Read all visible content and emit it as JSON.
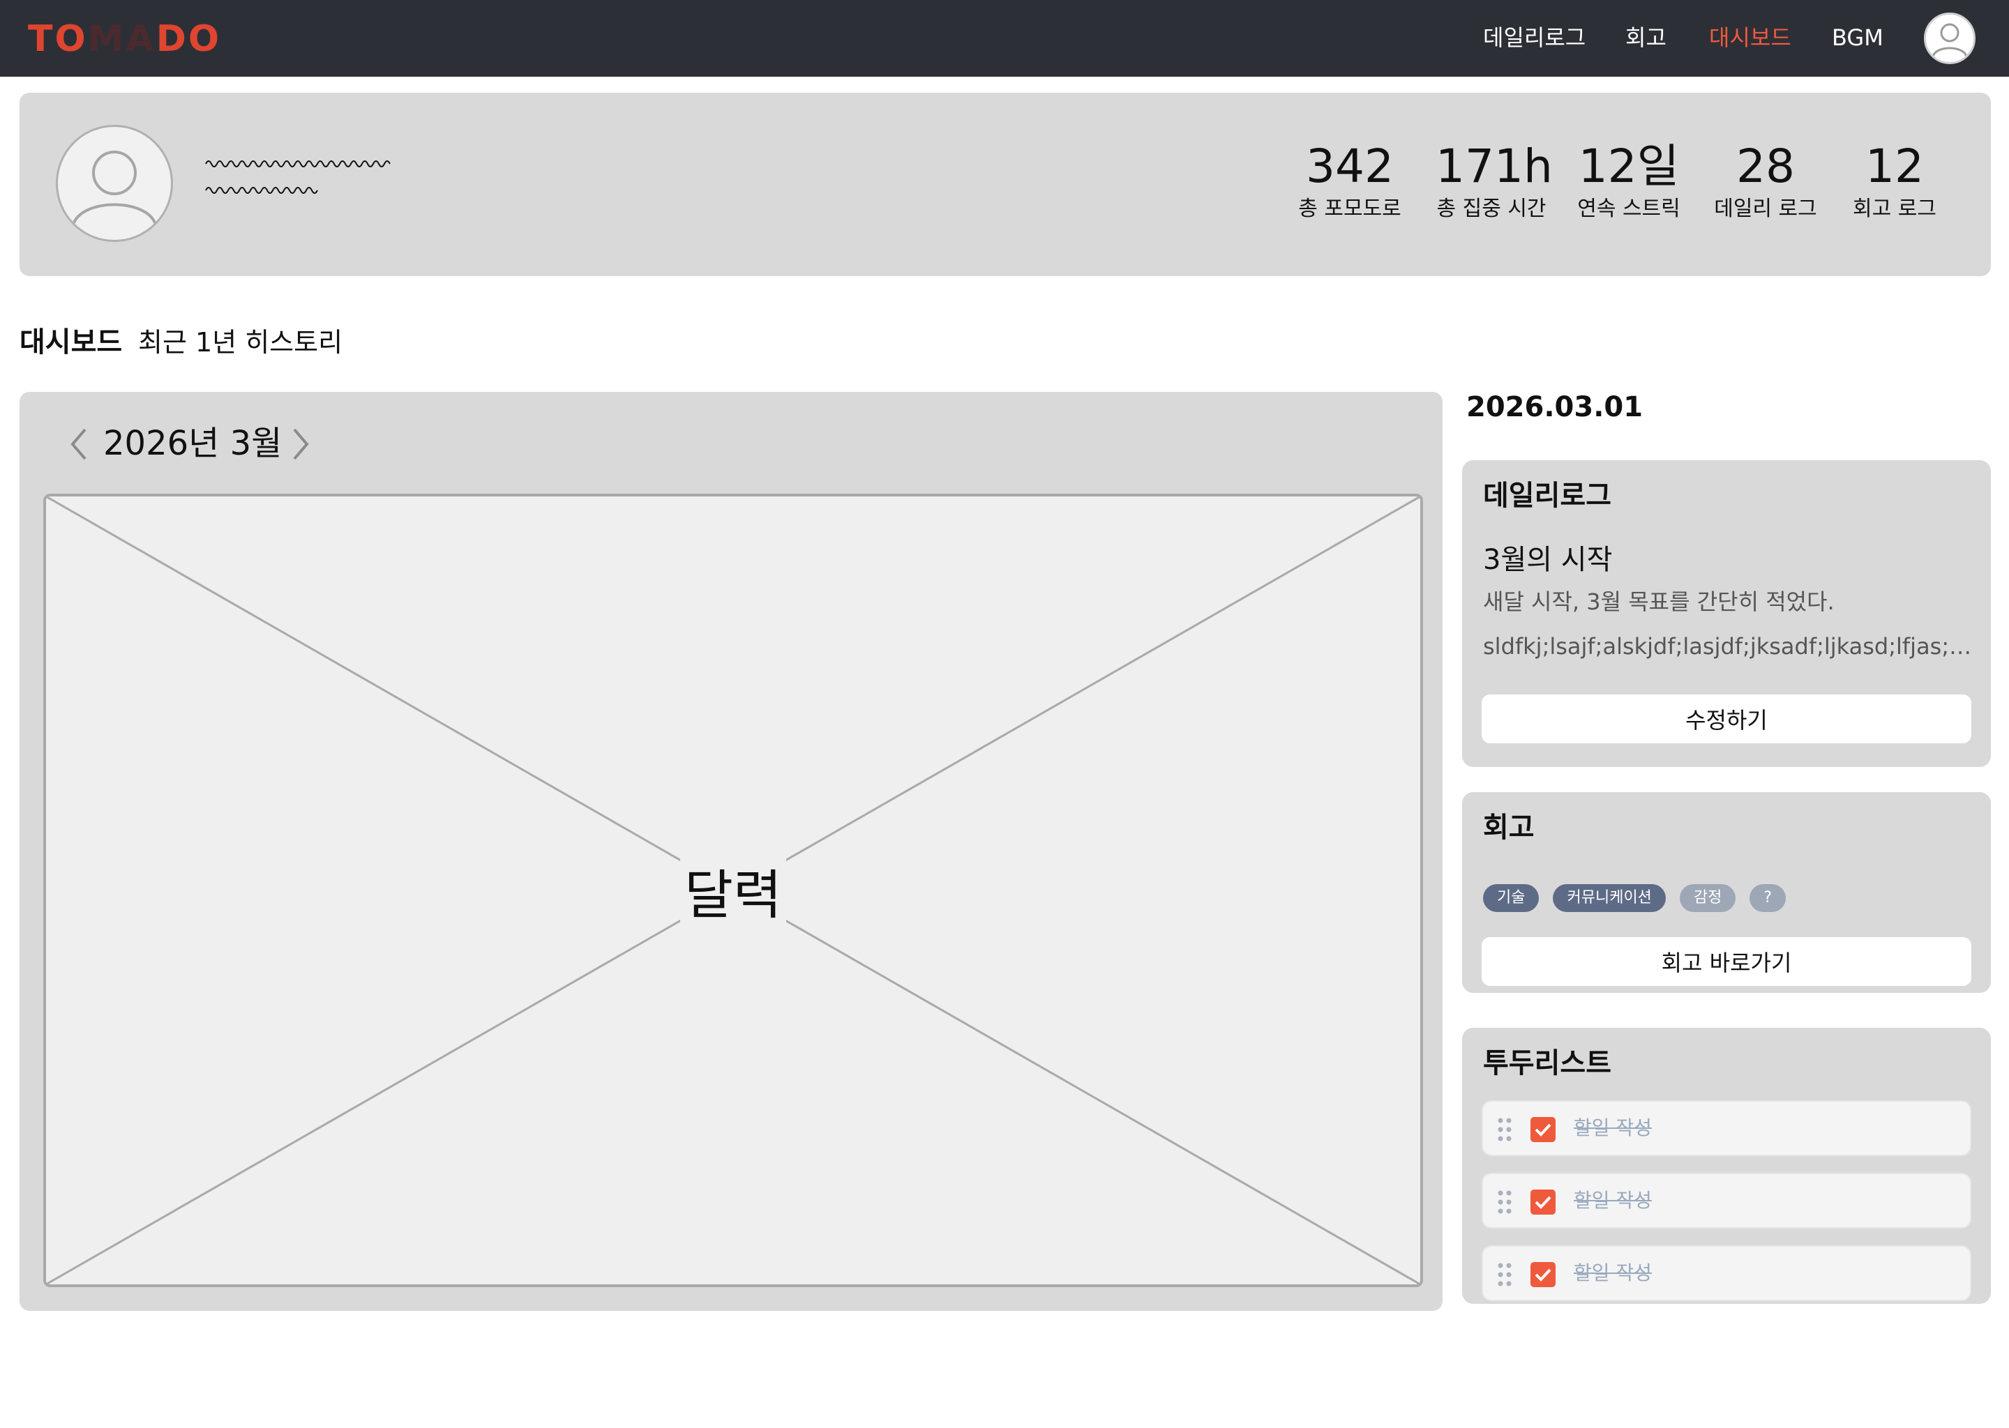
{
  "app": {
    "logo": "TOMADO",
    "logo_color": "#e0452f"
  },
  "nav": {
    "items": [
      {
        "label": "데일리로그",
        "active": false
      },
      {
        "label": "회고",
        "active": false
      },
      {
        "label": "대시보드",
        "active": true
      },
      {
        "label": "BGM",
        "active": false
      }
    ],
    "active_color": "#ef5a3c",
    "avatar_icon": "user-avatar-icon"
  },
  "profile": {
    "avatar_icon": "user-avatar-icon",
    "stats": [
      {
        "value": "342",
        "label": "총 포모도로"
      },
      {
        "value": "171h",
        "label": "총 집중 시간"
      },
      {
        "value": "12일",
        "label": "연속 스트릭"
      },
      {
        "value": "28",
        "label": "데일리 로그"
      },
      {
        "value": "12",
        "label": "회고 로그"
      }
    ]
  },
  "dashboard": {
    "title": "대시보드",
    "subtitle": "최근 1년 히스토리"
  },
  "calendar": {
    "month_label": "2026년 3월",
    "placeholder_label": "달력",
    "prev_icon": "chevron-left-icon",
    "next_icon": "chevron-right-icon"
  },
  "selected_date": "2026.03.01",
  "daily_log": {
    "title": "데일리로그",
    "entry_title": "3월의 시작",
    "entry_summary": "새달 시작, 3월 목표를 간단히 적었다.",
    "entry_body": "sldfkj;lsajf;alskjdf;lasjdf;jksadf;ljkasd;lfjas;ldfkj;asldkfj;asldkfj",
    "edit_button": "수정하기"
  },
  "retrospect": {
    "title": "회고",
    "tags": [
      {
        "label": "기술",
        "style": "dark"
      },
      {
        "label": "커뮤니케이션",
        "style": "dark"
      },
      {
        "label": "감정",
        "style": "light"
      },
      {
        "label": "?",
        "style": "light"
      }
    ],
    "go_button": "회고 바로가기"
  },
  "todo": {
    "title": "투두리스트",
    "items": [
      {
        "text": "할일 작성",
        "done": true
      },
      {
        "text": "할일 작성",
        "done": true
      },
      {
        "text": "할일 작성",
        "done": true
      }
    ],
    "check_color": "#ef5a3c",
    "drag_icon": "drag-handle-icon",
    "check_icon": "checkbox-checked-icon"
  }
}
